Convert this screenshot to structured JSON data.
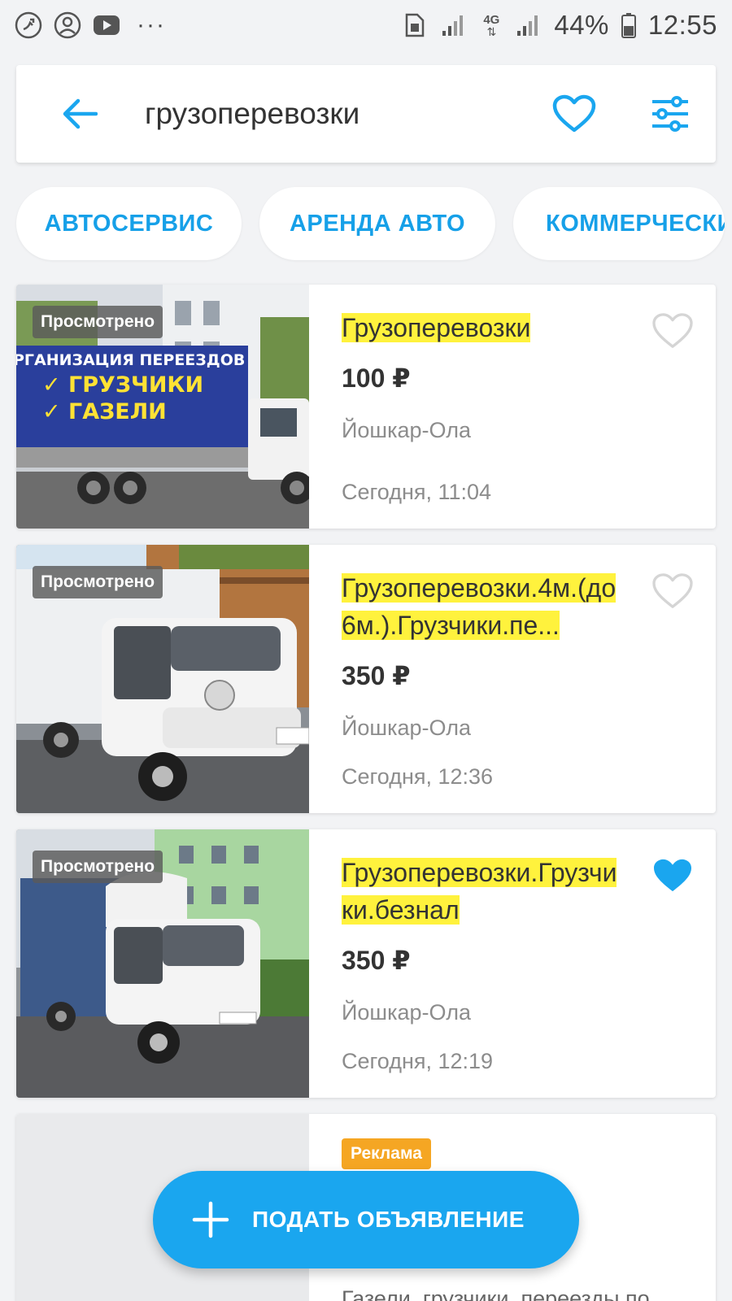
{
  "status_bar": {
    "left_icons": [
      "missed-call-icon",
      "account-circle-icon",
      "youtube-icon"
    ],
    "more": "···",
    "network": "4G",
    "battery": "44%",
    "time": "12:55"
  },
  "search": {
    "query": "грузоперевозки",
    "icons": [
      "back-arrow-icon",
      "heart-outline-icon",
      "filter-sliders-icon"
    ]
  },
  "chips": [
    "АВТОСЕРВИС",
    "АРЕНДА АВТО",
    "КОММЕРЧЕСКИ"
  ],
  "listings": [
    {
      "viewed": "Просмотрено",
      "title": "Грузоперевозки",
      "price": "100 ₽",
      "city": "Йошкар-Ола",
      "date": "Сегодня, 11:04",
      "favorited": false,
      "photo_text": [
        "РГАНИЗАЦИЯ ПЕРЕЕЗДОВ",
        "✓ ГРУЗЧИКИ",
        "✓ ГАЗЕЛИ"
      ]
    },
    {
      "viewed": "Просмотрено",
      "title": "Грузоперевозки.4м.(до 6м.).Грузчики.пе...",
      "price": "350 ₽",
      "city": "Йошкар-Ола",
      "date": "Сегодня, 12:36",
      "favorited": false
    },
    {
      "viewed": "Просмотрено",
      "title": "Грузоперевозки.Грузчики.безнал",
      "price": "350 ₽",
      "city": "Йошкар-Ола",
      "date": "Сегодня, 12:19",
      "favorited": true
    }
  ],
  "ad": {
    "badge": "Реклама",
    "description": "Газели, грузчики, переезды по"
  },
  "fab": {
    "label": "ПОДАТЬ ОБЪЯВЛЕНИЕ"
  },
  "colors": {
    "accent": "#1aa6ef",
    "chip_text": "#16a0e8",
    "title_highlight": "#fff23d",
    "ad_badge": "#f5a623",
    "background": "#f2f3f5"
  }
}
